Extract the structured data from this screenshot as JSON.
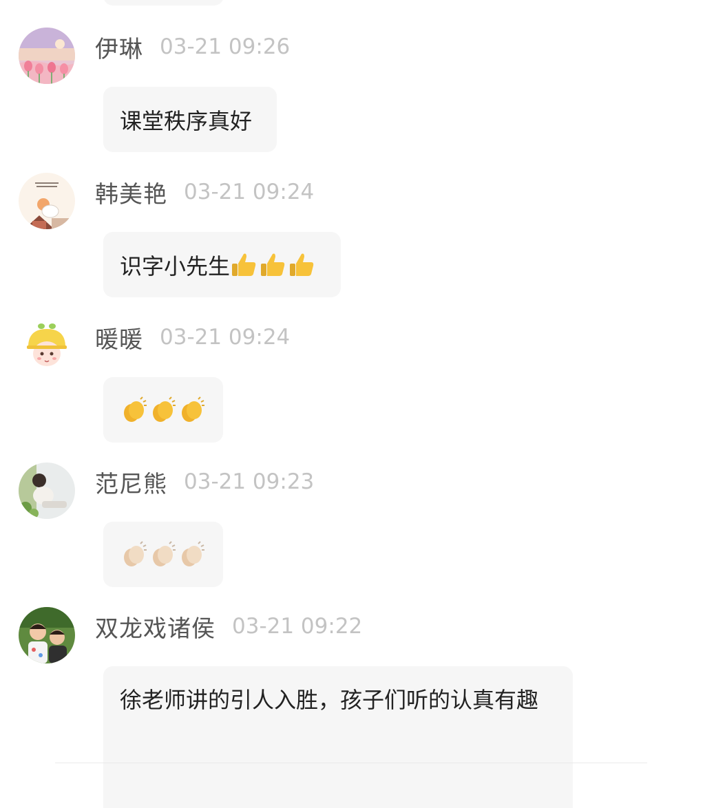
{
  "comments": [
    {
      "username": "伊琳",
      "time": "03-21 09:26",
      "text": "课堂秩序真好",
      "emoji_icon": "",
      "emoji_count": 0
    },
    {
      "username": "韩美艳",
      "time": "03-21 09:24",
      "text": "识字小先生",
      "emoji_icon": "thumbs-up-icon",
      "emoji_count": 3
    },
    {
      "username": "暖暖",
      "time": "03-21 09:24",
      "text": "",
      "emoji_icon": "clapping-hands-icon",
      "emoji_count": 3
    },
    {
      "username": "范尼熊",
      "time": "03-21 09:23",
      "text": "",
      "emoji_icon": "clapping-hands-light-icon",
      "emoji_count": 3
    },
    {
      "username": "双龙戏诸侯",
      "time": "03-21 09:22",
      "text": "徐老师讲的引人入胜，孩子们听的认真有趣",
      "emoji_icon": "",
      "emoji_count": 0
    }
  ],
  "colors": {
    "username": "#555555",
    "timestamp": "#c3c3c3",
    "bubble_background": "#f6f6f6",
    "message_text": "#222222",
    "emoji_yellow": "#f7c23a",
    "emoji_light": "#f1dcc4"
  }
}
